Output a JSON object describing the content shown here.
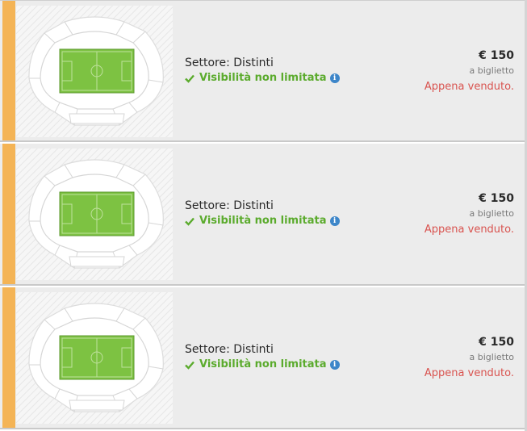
{
  "listings": [
    {
      "sector": "Settore: Distinti",
      "visibility": "Visibilità non limitata",
      "price": "€ 150",
      "per_ticket": "a biglietto",
      "status": "Appena venduto."
    },
    {
      "sector": "Settore: Distinti",
      "visibility": "Visibilità non limitata",
      "price": "€ 150",
      "per_ticket": "a biglietto",
      "status": "Appena venduto."
    },
    {
      "sector": "Settore: Distinti",
      "visibility": "Visibilità non limitata",
      "price": "€ 150",
      "per_ticket": "a biglietto",
      "status": "Appena venduto."
    }
  ],
  "icons": {
    "check": "check-icon",
    "info": "info-icon",
    "map": "stadium-map"
  },
  "colors": {
    "accent": "#f4b456",
    "visibility": "#5bab2d",
    "sold": "#d9534f",
    "pitch": "#7dc242",
    "info": "#3d86c9"
  }
}
